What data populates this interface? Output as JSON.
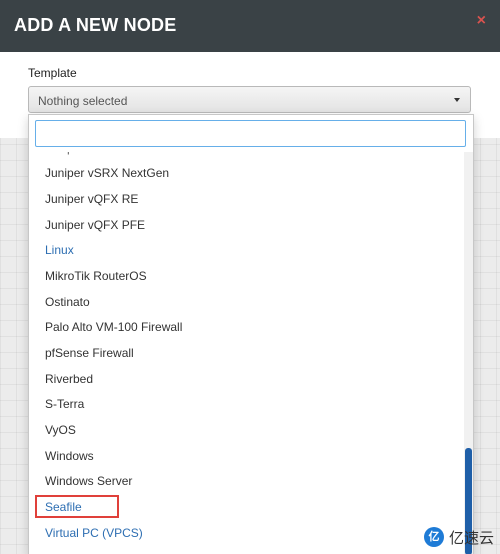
{
  "modal": {
    "title": "ADD A NEW NODE",
    "close_glyph": "×"
  },
  "template_field": {
    "label": "Template",
    "selected_value": "Nothing selected",
    "search_value": ""
  },
  "dropdown": {
    "partial_top_label": "Juniper vSRX",
    "options": [
      {
        "label": "Juniper vSRX NextGen",
        "kind": "item"
      },
      {
        "label": "Juniper vQFX RE",
        "kind": "item"
      },
      {
        "label": "Juniper vQFX PFE",
        "kind": "item"
      },
      {
        "label": "Linux",
        "kind": "group"
      },
      {
        "label": "MikroTik RouterOS",
        "kind": "item"
      },
      {
        "label": "Ostinato",
        "kind": "item"
      },
      {
        "label": "Palo Alto VM-100 Firewall",
        "kind": "item"
      },
      {
        "label": "pfSense Firewall",
        "kind": "item"
      },
      {
        "label": "Riverbed",
        "kind": "item"
      },
      {
        "label": "S-Terra",
        "kind": "item"
      },
      {
        "label": "VyOS",
        "kind": "item"
      },
      {
        "label": "Windows",
        "kind": "item"
      },
      {
        "label": "Windows Server",
        "kind": "item"
      },
      {
        "label": "Seafile",
        "kind": "active"
      },
      {
        "label": "Virtual PC (VPCS)",
        "kind": "group"
      }
    ]
  },
  "watermark": {
    "logo_text": "亿",
    "text": "亿速云"
  },
  "colors": {
    "header_bg": "#3a4246",
    "link_blue": "#2d6eb2",
    "highlight_red": "#e0403a",
    "scroll_thumb": "#1f5fa8"
  }
}
